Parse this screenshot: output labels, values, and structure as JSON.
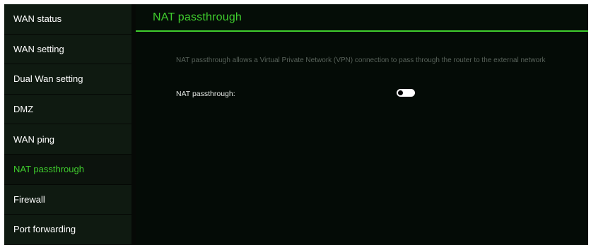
{
  "sidebar": {
    "items": [
      {
        "label": "WAN status",
        "active": false
      },
      {
        "label": "WAN setting",
        "active": false
      },
      {
        "label": "Dual Wan setting",
        "active": false
      },
      {
        "label": "DMZ",
        "active": false
      },
      {
        "label": "WAN ping",
        "active": false
      },
      {
        "label": "NAT passthrough",
        "active": true
      },
      {
        "label": "Firewall",
        "active": false
      },
      {
        "label": "Port forwarding",
        "active": false
      }
    ]
  },
  "main": {
    "title": "NAT passthrough",
    "description": "NAT passthrough allows a Virtual Private Network (VPN) connection to pass through the router to the external network",
    "setting": {
      "label": "NAT passthrough:",
      "enabled": false
    }
  },
  "colors": {
    "accent": "#3fcd2d",
    "background": "#040b06",
    "sidebar_background": "#0f1a11",
    "text": "#ffffff",
    "muted_text": "#58625a"
  }
}
